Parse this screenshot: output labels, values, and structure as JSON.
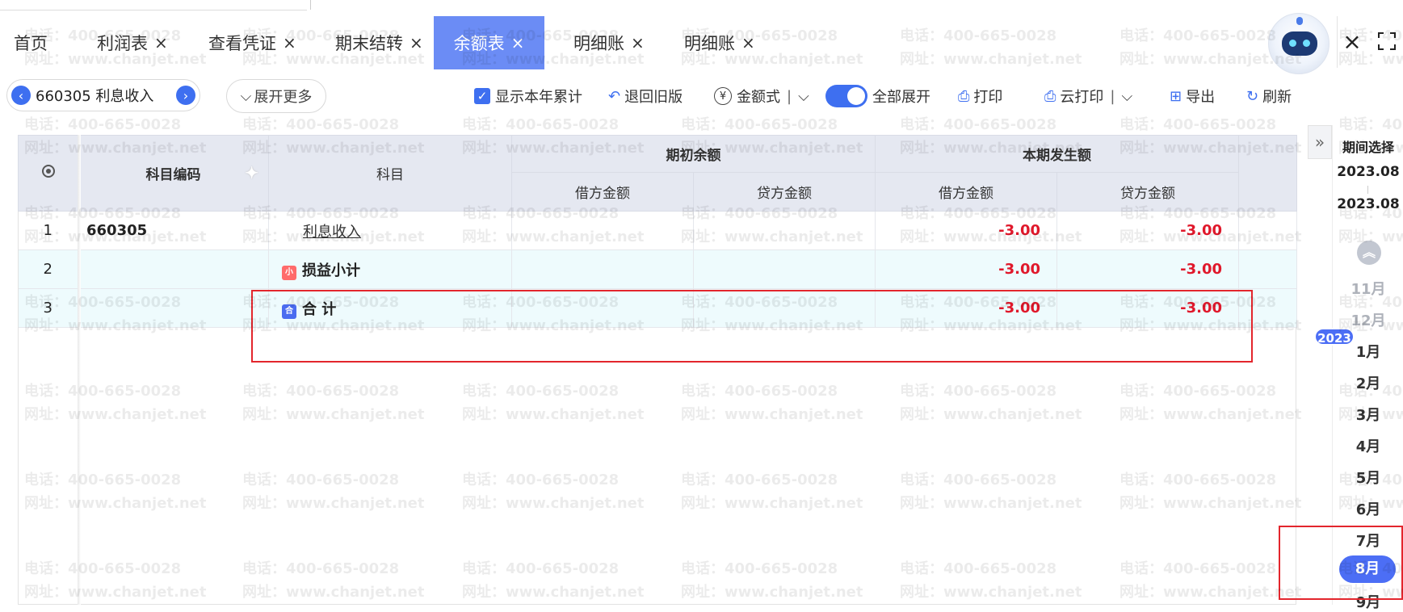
{
  "tabs": [
    {
      "label": "首页",
      "closable": false,
      "active": false
    },
    {
      "label": "利润表",
      "closable": true,
      "active": false
    },
    {
      "label": "查看凭证",
      "closable": true,
      "active": false
    },
    {
      "label": "期末结转",
      "closable": true,
      "active": false
    },
    {
      "label": "余额表",
      "closable": true,
      "active": true
    },
    {
      "label": "明细账",
      "closable": true,
      "active": false
    },
    {
      "label": "明细账",
      "closable": true,
      "active": false
    }
  ],
  "tab_close_glyph": "×",
  "window": {
    "close_glyph": "×"
  },
  "toolbar": {
    "account_selector": "660305 利息收入",
    "expand_more": "展开更多",
    "show_year_total": "显示本年累计",
    "revert_old": "退回旧版",
    "amount_format": "金额式",
    "expand_all": "全部展开",
    "print": "打印",
    "cloud_print": "云打印",
    "export": "导出",
    "refresh": "刷新"
  },
  "table": {
    "headers": {
      "code": "科目编码",
      "subject": "科目",
      "opening": "期初余额",
      "current": "本期发生额",
      "debit": "借方金额",
      "credit": "贷方金额"
    },
    "rows": [
      {
        "seq": "1",
        "code": "660305",
        "subject": "利息收入",
        "open_debit": "",
        "open_credit": "",
        "cur_debit": "-3.00",
        "cur_credit": "-3.00"
      },
      {
        "seq": "2",
        "code": "",
        "subject": "损益小计",
        "tag": "小",
        "open_debit": "",
        "open_credit": "",
        "cur_debit": "-3.00",
        "cur_credit": "-3.00"
      },
      {
        "seq": "3",
        "code": "",
        "subject": "合 计",
        "tag": "合",
        "open_debit": "",
        "open_credit": "",
        "cur_debit": "-3.00",
        "cur_credit": "-3.00"
      }
    ]
  },
  "period_panel": {
    "title": "期间选择",
    "start": "2023.08",
    "end": "2023.08",
    "year_badge": "2023",
    "months": [
      "11月",
      "12月",
      "1月",
      "2月",
      "3月",
      "4月",
      "5月",
      "6月",
      "7月",
      "8月",
      "9月"
    ],
    "selected_month": "8月"
  },
  "watermark": {
    "phone": "电话：400-665-0028",
    "site": "网址：www.chanjet.net"
  },
  "colors": {
    "accent": "#3e6ff0",
    "tab_active": "#6b8cf5",
    "negative": "#e0182b",
    "annotation": "#e3262d"
  }
}
